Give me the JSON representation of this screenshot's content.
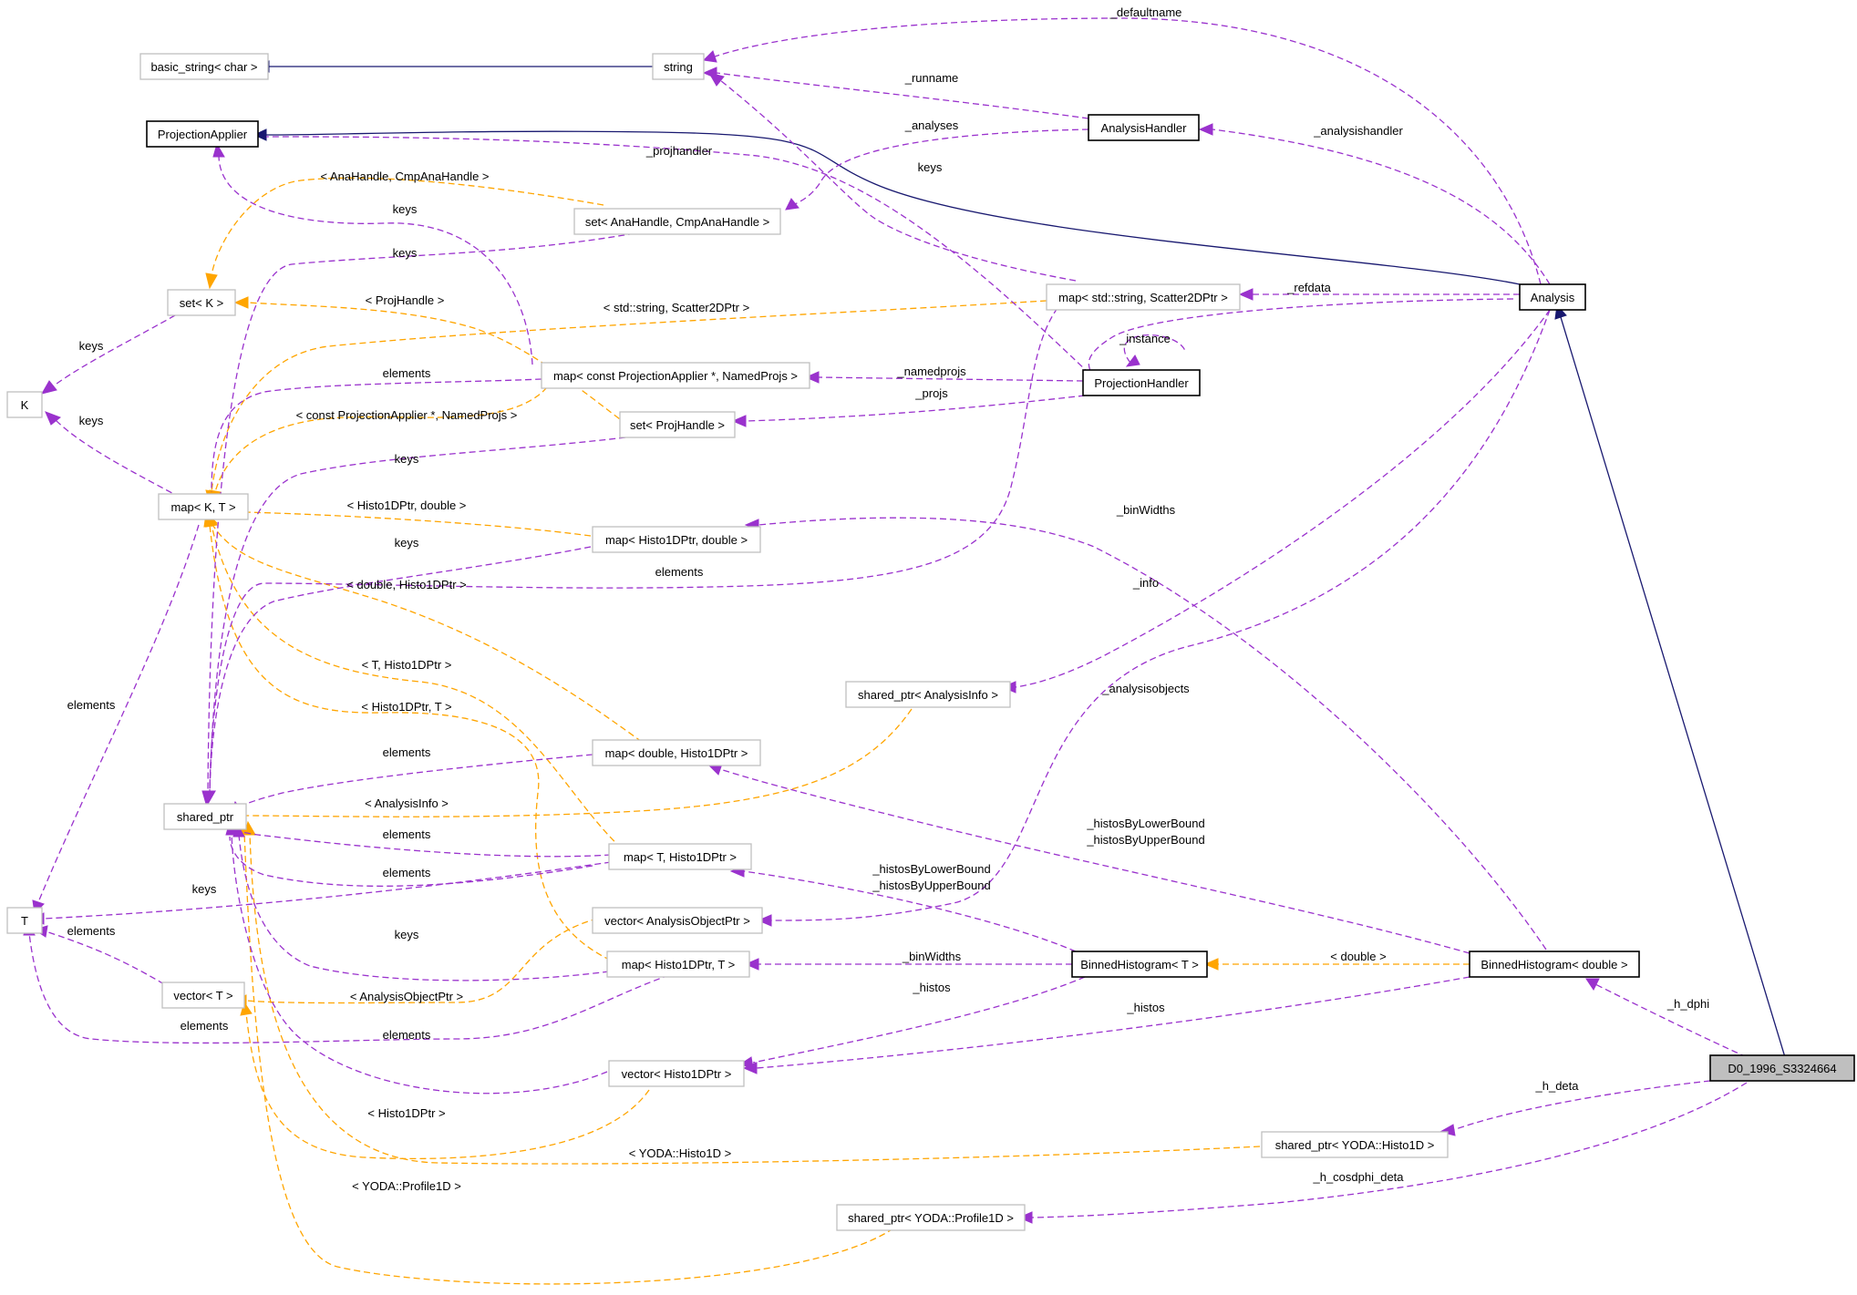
{
  "nodes": [
    {
      "id": "D0_1996_S3324664",
      "label": "D0_1996_S3324664",
      "kind": "focus"
    },
    {
      "id": "Analysis",
      "label": "Analysis",
      "kind": "main"
    },
    {
      "id": "ProjectionApplier",
      "label": "ProjectionApplier",
      "kind": "main"
    },
    {
      "id": "AnalysisHandler",
      "label": "AnalysisHandler",
      "kind": "main"
    },
    {
      "id": "ProjectionHandler",
      "label": "ProjectionHandler",
      "kind": "main"
    },
    {
      "id": "BinnedHistogramT",
      "label": "BinnedHistogram< T >",
      "kind": "main"
    },
    {
      "id": "BinnedHistogramDouble",
      "label": "BinnedHistogram< double >",
      "kind": "main"
    },
    {
      "id": "basic_string",
      "label": "basic_string< char >",
      "kind": "plain"
    },
    {
      "id": "string",
      "label": "string",
      "kind": "plain"
    },
    {
      "id": "setAnaHandle",
      "label": "set< AnaHandle, CmpAnaHandle >",
      "kind": "plain"
    },
    {
      "id": "setK",
      "label": "set< K >",
      "kind": "plain"
    },
    {
      "id": "K",
      "label": "K",
      "kind": "plain"
    },
    {
      "id": "mapStringScatter",
      "label": "map< std::string, Scatter2DPtr >",
      "kind": "plain"
    },
    {
      "id": "mapProjApplier",
      "label": "map< const ProjectionApplier *, NamedProjs >",
      "kind": "plain"
    },
    {
      "id": "setProjHandle",
      "label": "set< ProjHandle >",
      "kind": "plain"
    },
    {
      "id": "mapKT",
      "label": "map< K, T >",
      "kind": "plain"
    },
    {
      "id": "mapHisto1DDouble",
      "label": "map< Histo1DPtr, double >",
      "kind": "plain"
    },
    {
      "id": "sharedAnalysisInfo",
      "label": "shared_ptr< AnalysisInfo >",
      "kind": "plain"
    },
    {
      "id": "mapDoubleHisto",
      "label": "map< double, Histo1DPtr >",
      "kind": "plain"
    },
    {
      "id": "shared_ptr",
      "label": "shared_ptr",
      "kind": "plain"
    },
    {
      "id": "mapTHisto",
      "label": "map< T, Histo1DPtr >",
      "kind": "plain"
    },
    {
      "id": "T",
      "label": "T",
      "kind": "plain"
    },
    {
      "id": "vectorAnalysisObject",
      "label": "vector< AnalysisObjectPtr >",
      "kind": "plain"
    },
    {
      "id": "mapHistoT",
      "label": "map< Histo1DPtr, T >",
      "kind": "plain"
    },
    {
      "id": "vectorT",
      "label": "vector< T >",
      "kind": "plain"
    },
    {
      "id": "vectorHisto",
      "label": "vector< Histo1DPtr >",
      "kind": "plain"
    },
    {
      "id": "sharedYodaHisto",
      "label": "shared_ptr< YODA::Histo1D >",
      "kind": "plain"
    },
    {
      "id": "sharedYodaProfile",
      "label": "shared_ptr< YODA::Profile1D >",
      "kind": "plain"
    }
  ],
  "edge_labels": [
    {
      "id": "l_defaultname",
      "text": "_defaultname"
    },
    {
      "id": "l_runname",
      "text": "_runname"
    },
    {
      "id": "l_analyses",
      "text": "_analyses"
    },
    {
      "id": "l_analysishandler",
      "text": "_analysishandler"
    },
    {
      "id": "l_projhandler",
      "text": "_projhandler"
    },
    {
      "id": "l_keys_string",
      "text": "keys"
    },
    {
      "id": "l_anahandle_tpl",
      "text": "< AnaHandle, CmpAnaHandle >"
    },
    {
      "id": "l_keys_set_anahandle1",
      "text": "keys"
    },
    {
      "id": "l_keys_set_anahandle2",
      "text": "keys"
    },
    {
      "id": "l_projhandle_tpl",
      "text": "< ProjHandle >"
    },
    {
      "id": "l_string_scatter_tpl",
      "text": "< std::string, Scatter2DPtr >"
    },
    {
      "id": "l_refdata",
      "text": "_refdata"
    },
    {
      "id": "l_keys_setK",
      "text": "keys"
    },
    {
      "id": "l_instance",
      "text": "_instance"
    },
    {
      "id": "l_elements_mapproj",
      "text": "elements"
    },
    {
      "id": "l_namedprojs",
      "text": "_namedprojs"
    },
    {
      "id": "l_projs",
      "text": "_projs"
    },
    {
      "id": "l_keys_mapKT",
      "text": "keys"
    },
    {
      "id": "l_const_projapplier_tpl",
      "text": "< const ProjectionApplier *, NamedProjs >"
    },
    {
      "id": "l_keys_setprojhandle",
      "text": "keys"
    },
    {
      "id": "l_histo_double_tpl",
      "text": "< Histo1DPtr, double >"
    },
    {
      "id": "l_binwidths_top",
      "text": "_binWidths"
    },
    {
      "id": "l_keys_maphistodouble",
      "text": "keys"
    },
    {
      "id": "l_elements_scatter",
      "text": "elements"
    },
    {
      "id": "l_info",
      "text": "_info"
    },
    {
      "id": "l_double_histo_tpl",
      "text": "< double, Histo1DPtr >"
    },
    {
      "id": "l_t_histo_tpl",
      "text": "< T, Histo1DPtr >"
    },
    {
      "id": "l_analysisobjects",
      "text": "_analysisobjects"
    },
    {
      "id": "l_histo_t_tpl",
      "text": "< Histo1DPtr, T >"
    },
    {
      "id": "l_elements_mapKT",
      "text": "elements"
    },
    {
      "id": "l_elements_mapdouble",
      "text": "elements"
    },
    {
      "id": "l_analysisinfo_tpl",
      "text": "< AnalysisInfo >"
    },
    {
      "id": "l_histosbylower_a",
      "text": "_histosByLowerBound"
    },
    {
      "id": "l_histosbyupper_a",
      "text": "_histosByUpperBound"
    },
    {
      "id": "l_elements_mapT1",
      "text": "elements"
    },
    {
      "id": "l_elements_mapT2",
      "text": "elements"
    },
    {
      "id": "l_histosbylower_b",
      "text": "_histosByLowerBound"
    },
    {
      "id": "l_histosbyupper_b",
      "text": "_histosByUpperBound"
    },
    {
      "id": "l_keys_mapTHisto",
      "text": "keys"
    },
    {
      "id": "l_elements_vectorT",
      "text": "elements"
    },
    {
      "id": "l_keys_maphistoT",
      "text": "keys"
    },
    {
      "id": "l_binwidths_bottom",
      "text": "_binWidths"
    },
    {
      "id": "l_double_tpl",
      "text": "< double >"
    },
    {
      "id": "l_analysisobjectptr_tpl",
      "text": "< AnalysisObjectPtr >"
    },
    {
      "id": "l_histos_a",
      "text": "_histos"
    },
    {
      "id": "l_histos_b",
      "text": "_histos"
    },
    {
      "id": "l_h_dphi",
      "text": "_h_dphi"
    },
    {
      "id": "l_elements_T",
      "text": "elements"
    },
    {
      "id": "l_elements_vectorhisto",
      "text": "elements"
    },
    {
      "id": "l_h_deta",
      "text": "_h_deta"
    },
    {
      "id": "l_histo1dptr_tpl",
      "text": "< Histo1DPtr >"
    },
    {
      "id": "l_yoda_histo_tpl",
      "text": "< YODA::Histo1D >"
    },
    {
      "id": "l_h_cosdphi_deta",
      "text": "_h_cosdphi_deta"
    },
    {
      "id": "l_yoda_profile_tpl",
      "text": "< YODA::Profile1D >"
    }
  ]
}
